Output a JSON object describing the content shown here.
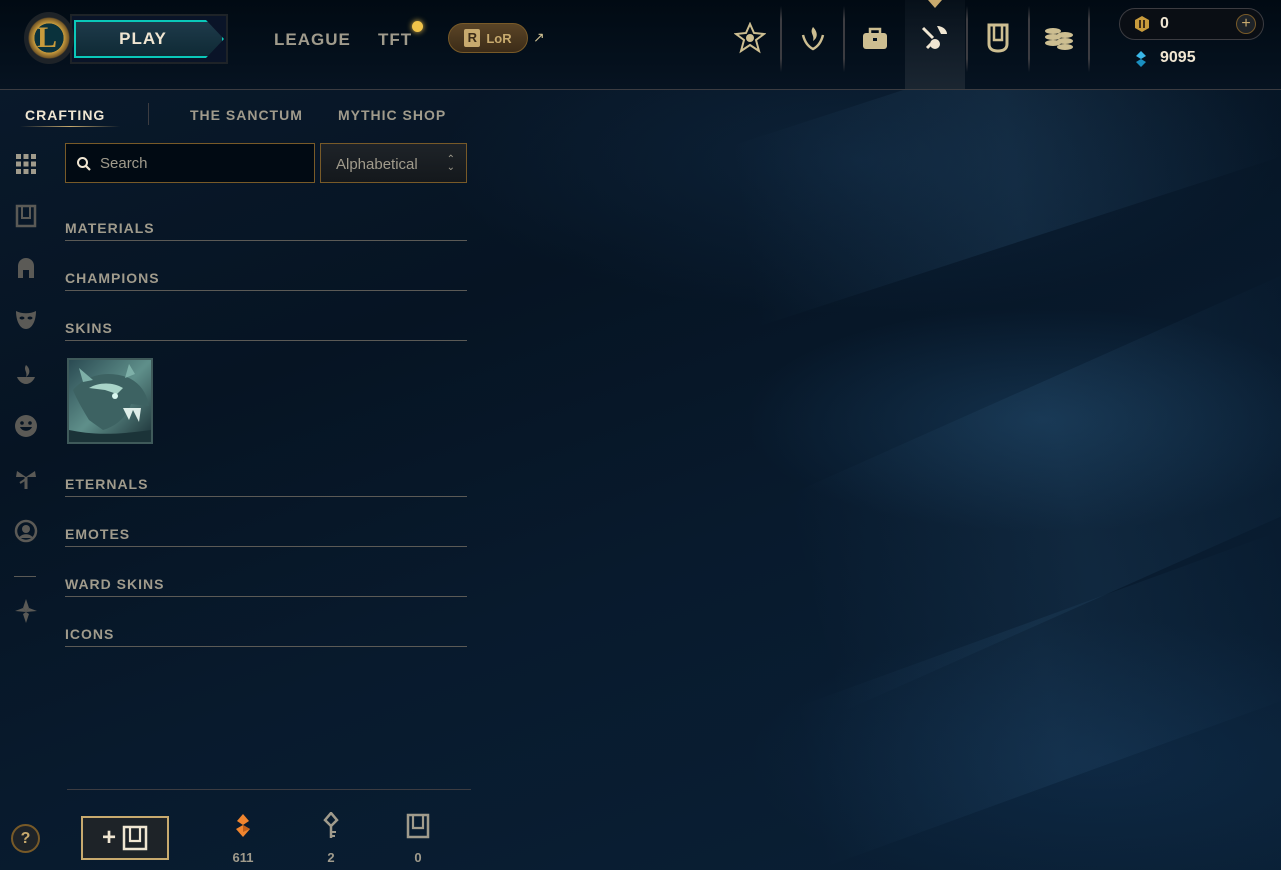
{
  "header": {
    "play_label": "PLAY",
    "nav": {
      "league": "LEAGUE",
      "tft": "TFT",
      "lor": "LoR",
      "lor_badge": "R"
    },
    "icons": [
      "rank-icon",
      "honor-icon",
      "collection-icon",
      "loot-icon",
      "chest-icon",
      "store-icon"
    ],
    "active_icon": "loot-icon",
    "currency": {
      "rp": "0",
      "blue_essence": "9095"
    }
  },
  "subtabs": {
    "crafting": "CRAFTING",
    "sanctum": "THE SANCTUM",
    "mythic_shop": "MYTHIC SHOP"
  },
  "sidebar": {
    "icons": [
      "grid-icon",
      "chest-icon",
      "helmet-icon",
      "mask-icon",
      "ward-icon",
      "emote-icon",
      "tree-icon",
      "avatar-icon",
      "compass-icon"
    ]
  },
  "search": {
    "placeholder": "Search",
    "value": ""
  },
  "sort": {
    "selected": "Alphabetical"
  },
  "categories": [
    {
      "label": "MATERIALS"
    },
    {
      "label": "CHAMPIONS"
    },
    {
      "label": "SKINS"
    },
    {
      "label": "ETERNALS"
    },
    {
      "label": "EMOTES"
    },
    {
      "label": "WARD SKINS"
    },
    {
      "label": "ICONS"
    }
  ],
  "footer": {
    "help": "?",
    "orange_essence": "611",
    "keys": "2",
    "chests": "0"
  },
  "colors": {
    "gold": "#c8aa6e",
    "teal": "#0ac8b9",
    "orange": "#f0852f",
    "blue": "#3ab7e8"
  }
}
